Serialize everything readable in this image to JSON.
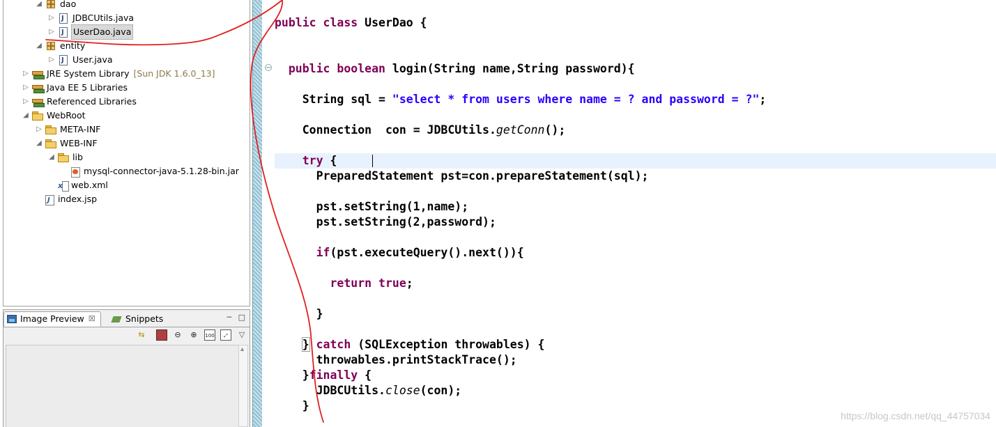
{
  "package_explorer": {
    "items": [
      {
        "label": "dao",
        "type": "package",
        "expanded": true
      },
      {
        "label": "JDBCUtils.java",
        "type": "java"
      },
      {
        "label": "UserDao.java",
        "type": "java",
        "selected": true
      },
      {
        "label": "entity",
        "type": "package",
        "expanded": true
      },
      {
        "label": "User.java",
        "type": "java"
      },
      {
        "label": "JRE System Library",
        "decoration": "[Sun JDK 1.6.0_13]",
        "type": "library"
      },
      {
        "label": "Java EE 5 Libraries",
        "type": "library"
      },
      {
        "label": "Referenced Libraries",
        "type": "library"
      },
      {
        "label": "WebRoot",
        "type": "folder",
        "expanded": true
      },
      {
        "label": "META-INF",
        "type": "folder"
      },
      {
        "label": "WEB-INF",
        "type": "folder",
        "expanded": true
      },
      {
        "label": "lib",
        "type": "folder",
        "expanded": true
      },
      {
        "label": "mysql-connector-java-5.1.28-bin.jar",
        "type": "jar"
      },
      {
        "label": "web.xml",
        "type": "xml"
      },
      {
        "label": "index.jsp",
        "type": "jsp"
      }
    ]
  },
  "bottom_panel": {
    "tabs": [
      {
        "label": "Image Preview",
        "icon": "image-preview-icon",
        "active": true,
        "close": "☒"
      },
      {
        "label": "Snippets",
        "icon": "snippets-icon"
      }
    ],
    "toolbar_icons": [
      "link-icon",
      "fit-image-icon",
      "zoom-out-icon",
      "zoom-in-icon",
      "actual-size-icon",
      "fit-window-icon",
      "view-menu-icon"
    ]
  },
  "editor": {
    "code_lines": [
      "public class UserDao {",
      "public boolean login(String name,String password){",
      "String sql = \"select * from users where name = ? and password = ?\";",
      "Connection  con = JDBCUtils.getConn();",
      "try {",
      "PreparedStatement pst=con.prepareStatement(sql);",
      "pst.setString(1,name);",
      "pst.setString(2,password);",
      "if(pst.executeQuery().next()){",
      "return true;",
      "}",
      "} catch (SQLException throwables) {",
      "throwables.printStackTrace();",
      "}finally {",
      "JDBCUtils.close(con);",
      "}"
    ],
    "syntax": {
      "public": "public",
      "class": "class",
      "boolean": "boolean",
      "try": "try",
      "if": "if",
      "return": "return",
      "true": "true",
      "catch": "catch",
      "finally": "finally",
      "class_name": "UserDao",
      "method": "login",
      "string_literal": "\"select * from users where name = ? and password = ?\"",
      "get_conn": "getConn",
      "close": "close"
    },
    "colors": {
      "keyword": "#7f0055",
      "string": "#2a00ff",
      "current_line": "#e8f2fe",
      "annotation": "#e02020"
    }
  },
  "watermark": "https://blog.csdn.net/qq_44757034"
}
